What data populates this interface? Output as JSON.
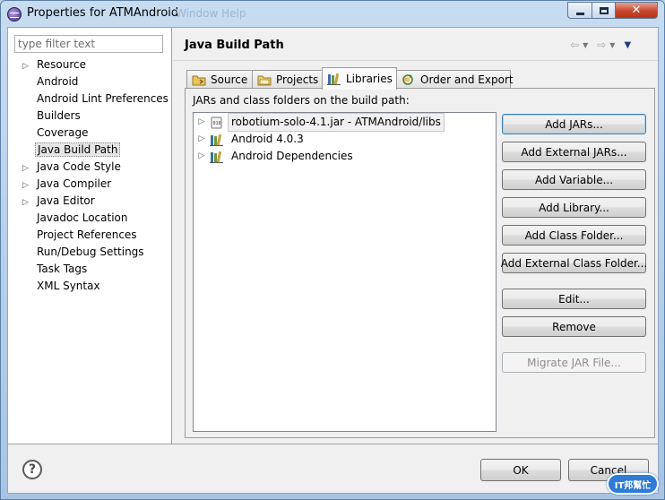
{
  "window": {
    "title": "Properties for ATMAndroid",
    "ghost_title": "Window    Help",
    "minimize_label": "",
    "maximize_label": "",
    "close_label": "✕"
  },
  "left": {
    "filter_placeholder": "type filter text",
    "items": [
      {
        "label": "Resource",
        "expandable": true
      },
      {
        "label": "Android",
        "expandable": false
      },
      {
        "label": "Android Lint Preferences",
        "expandable": false
      },
      {
        "label": "Builders",
        "expandable": false
      },
      {
        "label": "Coverage",
        "expandable": false
      },
      {
        "label": "Java Build Path",
        "expandable": false,
        "selected": true
      },
      {
        "label": "Java Code Style",
        "expandable": true
      },
      {
        "label": "Java Compiler",
        "expandable": true
      },
      {
        "label": "Java Editor",
        "expandable": true
      },
      {
        "label": "Javadoc Location",
        "expandable": false
      },
      {
        "label": "Project References",
        "expandable": false
      },
      {
        "label": "Run/Debug Settings",
        "expandable": false
      },
      {
        "label": "Task Tags",
        "expandable": false
      },
      {
        "label": "XML Syntax",
        "expandable": false
      }
    ]
  },
  "right": {
    "page_title": "Java Build Path",
    "tabs": [
      {
        "label": "Source",
        "icon": "source-folder-icon"
      },
      {
        "label": "Projects",
        "icon": "projects-folder-icon"
      },
      {
        "label": "Libraries",
        "icon": "libraries-icon",
        "active": true
      },
      {
        "label": "Order and Export",
        "icon": "order-export-icon"
      }
    ],
    "panel_label": "JARs and class folders on the build path:",
    "libraries": [
      {
        "label": "robotium-solo-4.1.jar - ATMAndroid/libs",
        "icon": "jar-file-icon",
        "selected": true
      },
      {
        "label": "Android 4.0.3",
        "icon": "library-container-icon"
      },
      {
        "label": "Android Dependencies",
        "icon": "library-container-icon"
      }
    ],
    "buttons": {
      "add_jars": "Add JARs...",
      "add_external_jars": "Add External JARs...",
      "add_variable": "Add Variable...",
      "add_library": "Add Library...",
      "add_class_folder": "Add Class Folder...",
      "add_external_class_folder": "Add External Class Folder...",
      "edit": "Edit...",
      "remove": "Remove",
      "migrate_jar": "Migrate JAR File..."
    }
  },
  "bottom": {
    "help": "?",
    "ok": "OK",
    "cancel": "Cancel"
  },
  "watermark": "IT邦幫忙",
  "colors": {
    "title_bar": "#c7dcf1",
    "close_button": "#c7452d",
    "focus_border": "#3c7fb1"
  }
}
